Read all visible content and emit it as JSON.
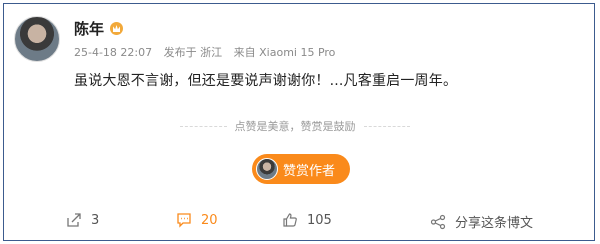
{
  "post": {
    "author": "陈年",
    "datetime": "25-4-18 22:07",
    "location": "发布于 浙江",
    "device": "来自 Xiaomi 15 Pro",
    "content": "虽说大恩不言谢，但还是要说声谢谢你！...凡客重启一周年。"
  },
  "reward": {
    "slogan": "点赞是美意，赞赏是鼓励",
    "button_label": "赞赏作者"
  },
  "actions": {
    "share_count": "3",
    "comment_count": "20",
    "like_count": "105",
    "share_image_label": "分享这条博文"
  },
  "colors": {
    "accent": "#fa8a1b",
    "frame": "#3c5b8e",
    "verified_badge": "#f2a93a"
  },
  "icons": {
    "forward": "forward-icon",
    "comment": "comment-icon",
    "like": "thumbs-up-icon",
    "share": "share-icon",
    "badge": "crown-badge-icon"
  }
}
